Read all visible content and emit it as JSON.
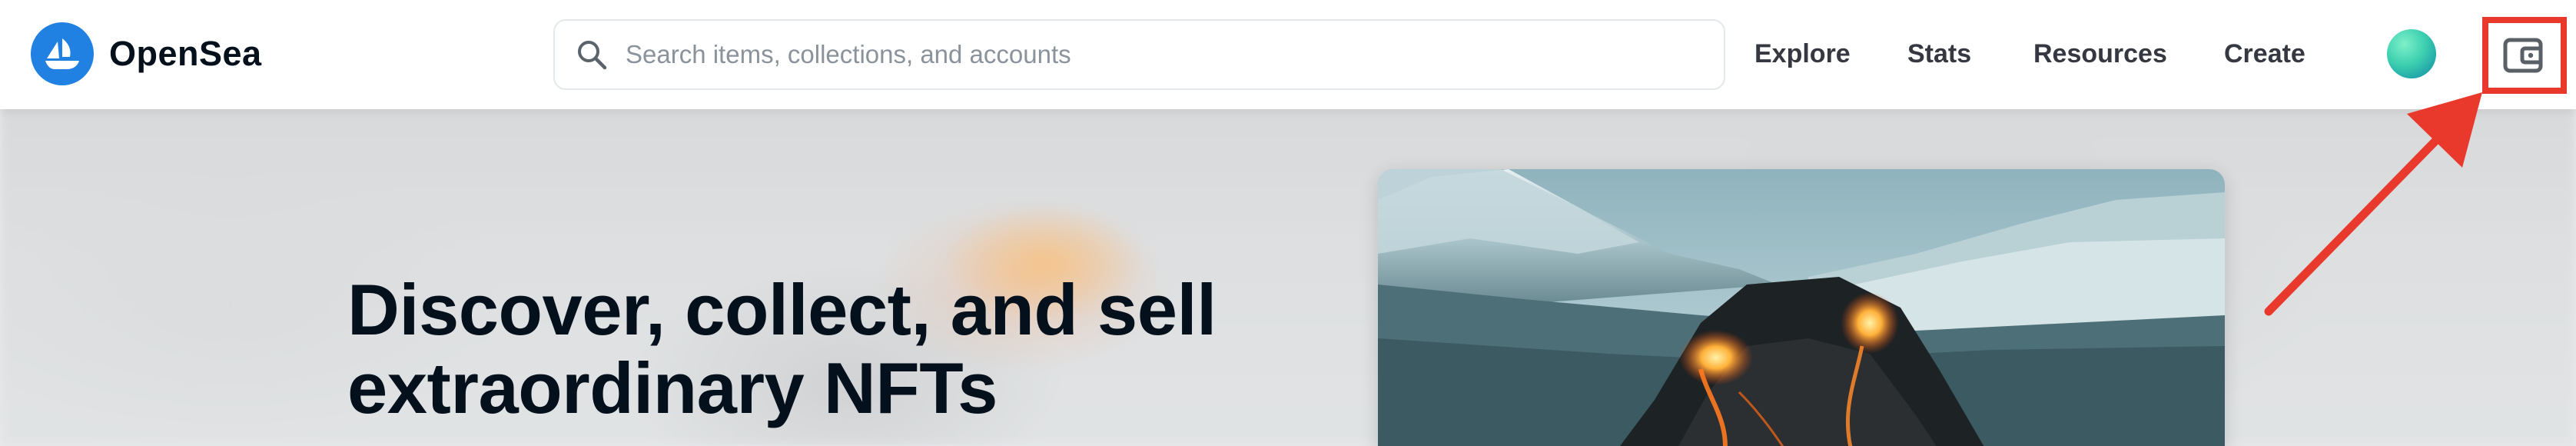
{
  "brand": {
    "name": "OpenSea"
  },
  "search": {
    "placeholder": "Search items, collections, and accounts",
    "value": ""
  },
  "nav": {
    "links": [
      {
        "label": "Explore"
      },
      {
        "label": "Stats"
      },
      {
        "label": "Resources"
      },
      {
        "label": "Create"
      }
    ]
  },
  "header": {
    "avatar_icon": "user-avatar-gradient",
    "wallet_icon": "wallet-icon"
  },
  "hero": {
    "heading_line1": "Discover, collect, and sell",
    "heading_line2": "extraordinary NFTs",
    "featured_image": "volcano-eruption-artwork"
  },
  "annotation": {
    "highlight_color": "#e8392c"
  },
  "colors": {
    "brand_blue": "#2081e2",
    "text_dark": "#04111d",
    "nav_text": "#353840"
  }
}
